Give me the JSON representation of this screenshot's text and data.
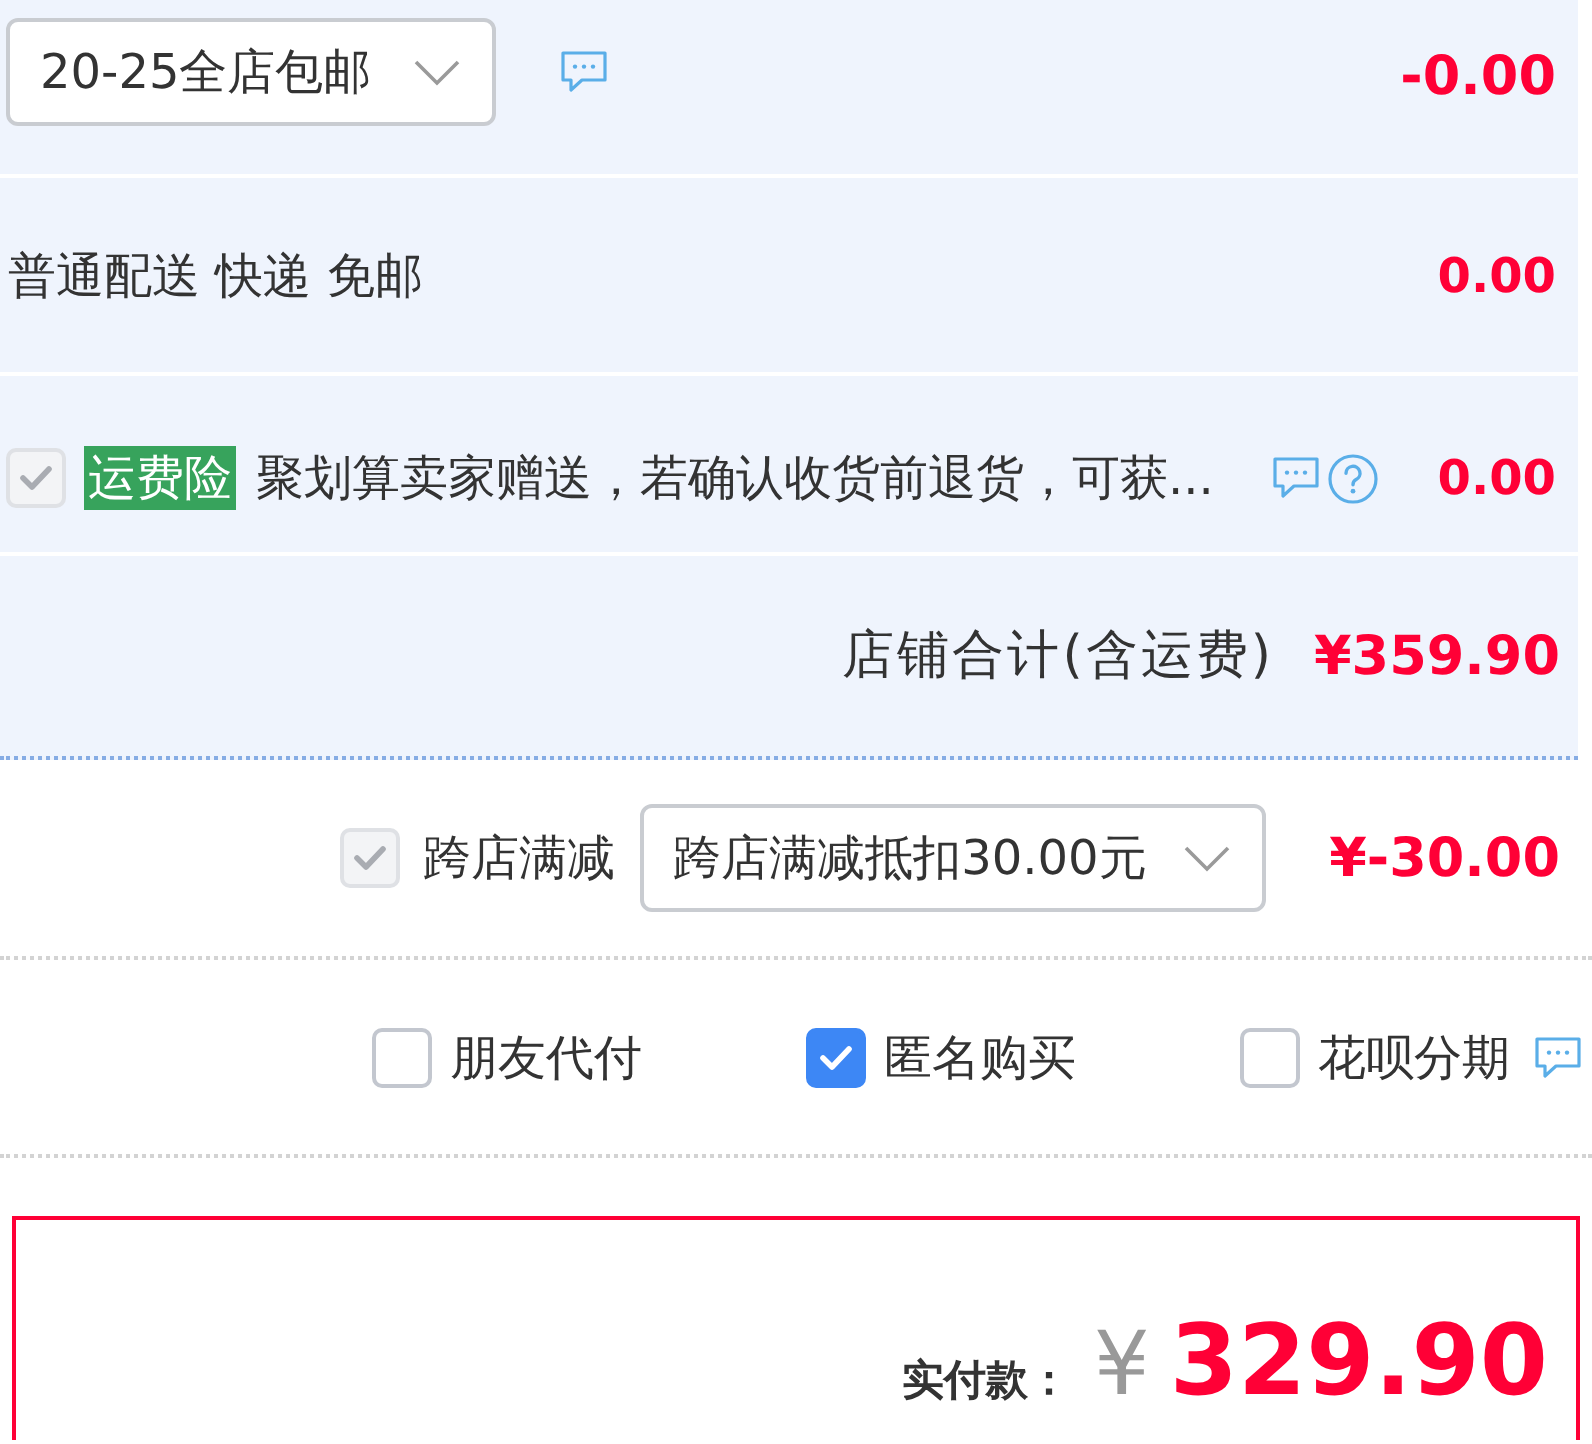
{
  "shop": {
    "promotion": {
      "select_value": "20-25全店包邮",
      "amount": "-0.00"
    },
    "delivery": {
      "text": "普通配送 快递 免邮",
      "amount": "0.00"
    },
    "shipping_insurance": {
      "checked": true,
      "disabled": true,
      "tag": "运费险",
      "description": "聚划算卖家赠送，若确认收货前退货，可获...",
      "amount": "0.00"
    },
    "subtotal": {
      "label": "店铺合计(含运费)",
      "amount": "¥359.90"
    }
  },
  "cross_store_discount": {
    "checked": true,
    "disabled": true,
    "label": "跨店满减",
    "select_value": "跨店满减抵扣30.00元",
    "amount": "¥-30.00"
  },
  "options": [
    {
      "label": "朋友代付",
      "checked": false,
      "comment_icon": false
    },
    {
      "label": "匿名购买",
      "checked": true,
      "comment_icon": false
    },
    {
      "label": "花呗分期",
      "checked": false,
      "comment_icon": true
    }
  ],
  "total": {
    "label": "实付款：",
    "currency": "¥",
    "amount": "329.90"
  }
}
